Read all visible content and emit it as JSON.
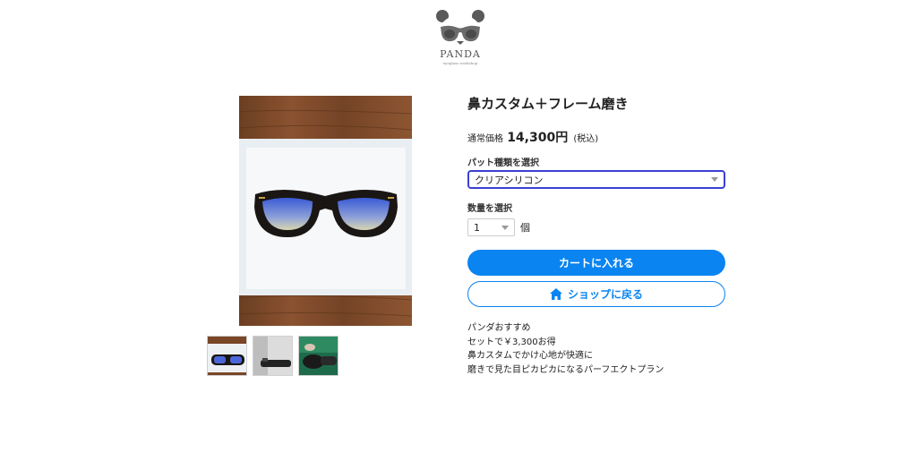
{
  "logo": {
    "name": "PANDA",
    "subtitle": "eyeglass workshop"
  },
  "product": {
    "title": "鼻カスタム＋フレーム磨き",
    "price_prefix": "通常価格",
    "price": "14,300円",
    "tax_note": "(税込)"
  },
  "pad_select": {
    "label": "パット種類を選択",
    "value": "クリアシリコン"
  },
  "quantity": {
    "label": "数量を選択",
    "value": "1",
    "unit": "個"
  },
  "buttons": {
    "cart": "カートに入れる",
    "back_to_shop": "ショップに戻る"
  },
  "description": [
    "パンダおすすめ",
    "セットで￥3,300お得",
    "鼻カスタムでかけ心地が快適に",
    "磨きで見た目ピカピカになるパーフエクトプラン"
  ],
  "colors": {
    "accent": "#0a84f0",
    "select_border": "#3a3fd6"
  }
}
